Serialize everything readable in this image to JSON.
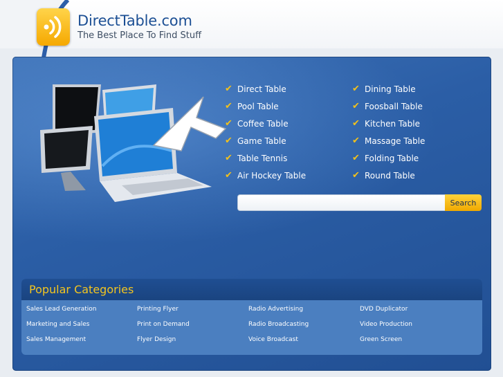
{
  "site": {
    "title": "DirectTable.com",
    "tagline": "The Best Place To Find Stuff"
  },
  "colors": {
    "brand_blue": "#2b5ea6",
    "accent_gold": "#f4c21a",
    "title_blue": "#1c4f94"
  },
  "logo": {
    "icon": "sound-waves-icon"
  },
  "keywords": {
    "column1": [
      "Direct Table",
      "Pool Table",
      "Coffee Table",
      "Game Table",
      "Table Tennis",
      "Air Hockey Table"
    ],
    "column2": [
      "Dining Table",
      "Foosball Table",
      "Kitchen Table",
      "Massage Table",
      "Folding Table",
      "Round Table"
    ]
  },
  "search": {
    "value": "",
    "placeholder": "",
    "button_label": "Search"
  },
  "popular": {
    "title": "Popular Categories",
    "columns": [
      [
        "Sales Lead Generation",
        "Marketing and Sales",
        "Sales Management"
      ],
      [
        "Printing Flyer",
        "Print on Demand",
        "Flyer Design"
      ],
      [
        "Radio Advertising",
        "Radio Broadcasting",
        "Voice Broadcast"
      ],
      [
        "DVD Duplicator",
        "Video Production",
        "Green Screen"
      ]
    ]
  }
}
